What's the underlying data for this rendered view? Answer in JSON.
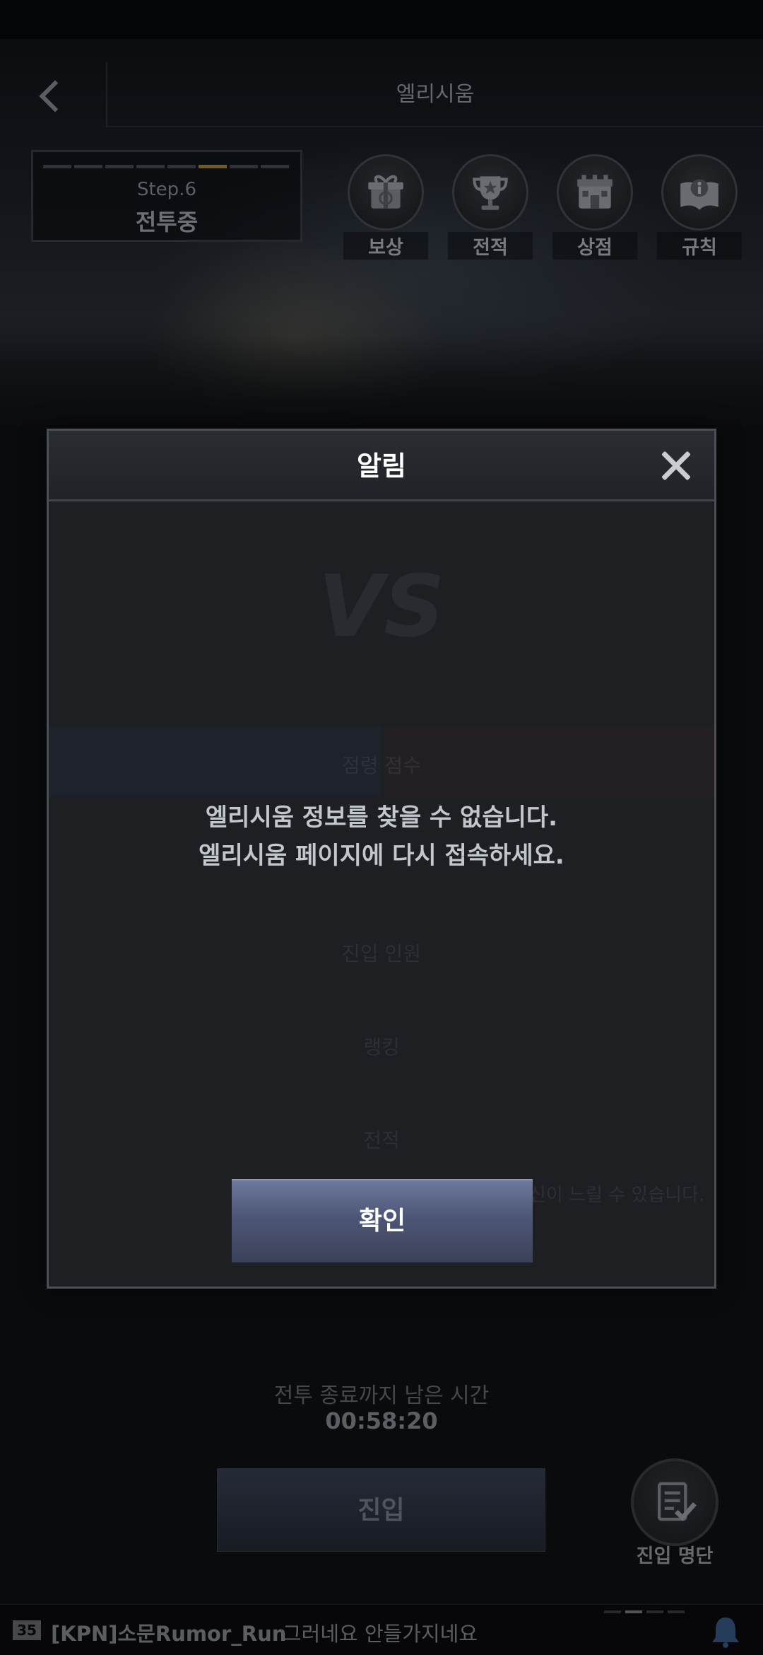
{
  "header": {
    "title": "엘리시움"
  },
  "step": {
    "label": "Step.6",
    "status": "전투중",
    "segments": 8,
    "active_segment": 6
  },
  "menu": {
    "items": [
      {
        "label": "보상",
        "icon": "gift-icon"
      },
      {
        "label": "전적",
        "icon": "trophy-icon"
      },
      {
        "label": "상점",
        "icon": "shop-icon"
      },
      {
        "label": "규칙",
        "icon": "rulebook-icon"
      }
    ]
  },
  "footer": {
    "remain_label": "전투 종료까지 남은 시간",
    "remain_time": "00:58:20",
    "enter_label": "진입",
    "entry_list_label": "진입 명단"
  },
  "chat": {
    "level": "35",
    "sender": "[KPN]소문Rumor_Run",
    "message": "그러네요 안들가지네요"
  },
  "dialog": {
    "title": "알림",
    "message_line1": "엘리시움 정보를 찾을 수 없습니다.",
    "message_line2": "엘리시움 페이지에 다시 접속하세요.",
    "confirm_label": "확인"
  },
  "background_ghost": {
    "vs": "VS",
    "score_label": "점령 점수",
    "entrants_label": "진입 인원",
    "ranking_label": "랭킹",
    "record_label": "전적",
    "note": "신이 느릴 수 있습니다."
  },
  "colors": {
    "accent_gold": "#b58a2a",
    "confirm_button": "#4d5676",
    "dialog_bg": "#1d1f23"
  }
}
